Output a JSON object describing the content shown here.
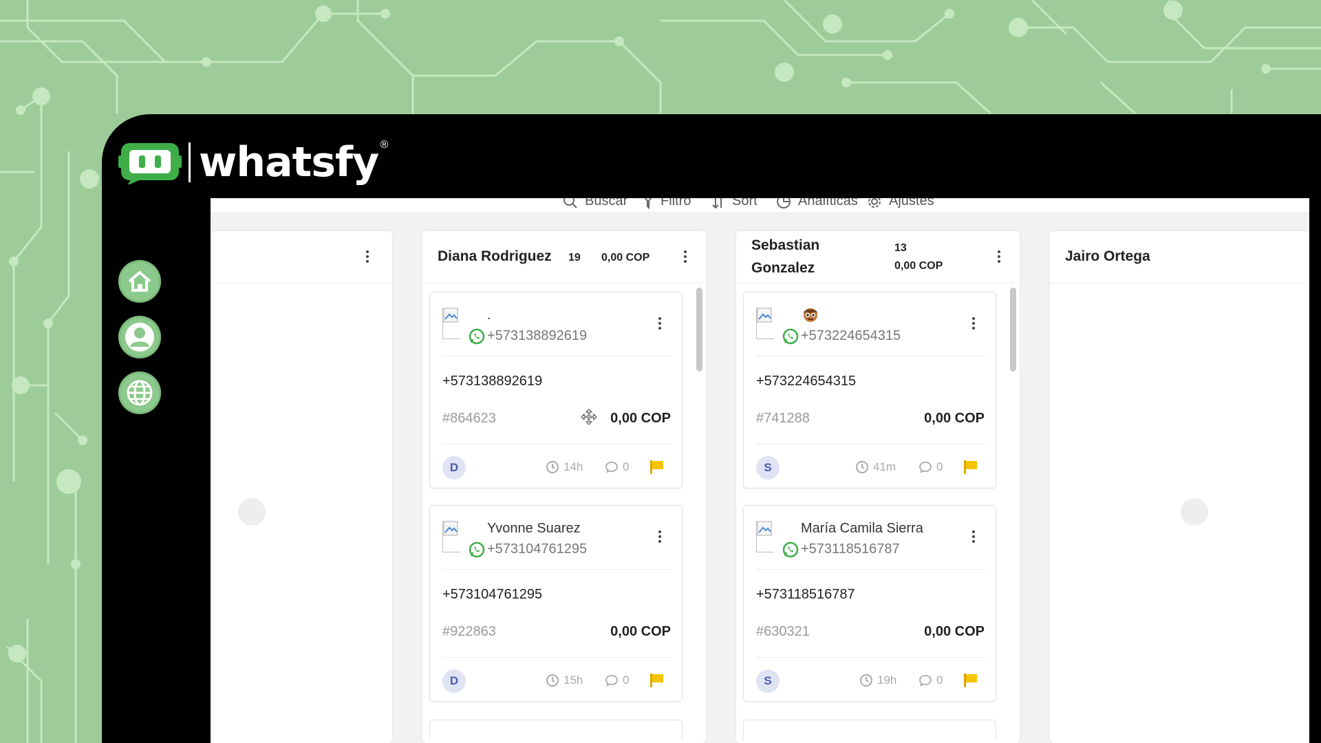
{
  "brand": {
    "name": "whatsfy",
    "registered": "®"
  },
  "nav": [
    {
      "icon": "home-icon"
    },
    {
      "icon": "user-icon"
    },
    {
      "icon": "globe-icon"
    }
  ],
  "toolbar": {
    "search": "Buscar",
    "filter": "Filtro",
    "sort": "Sort",
    "analytics": "Analíticas",
    "settings": "Ajustes"
  },
  "columns": [
    {
      "name": "",
      "count": "",
      "total": ""
    },
    {
      "name": "Diana Rodriguez",
      "count": "19",
      "total": "0,00 COP",
      "cards": [
        {
          "name": ".",
          "wa_phone": "+573138892619",
          "phone": "+573138892619",
          "id": "#864623",
          "amount": "0,00 COP",
          "agent": "D",
          "time": "14h",
          "messages": "0"
        },
        {
          "name": "Yvonne Suarez",
          "wa_phone": "+573104761295",
          "phone": "+573104761295",
          "id": "#922863",
          "amount": "0,00 COP",
          "agent": "D",
          "time": "15h",
          "messages": "0"
        }
      ]
    },
    {
      "name_line1": "Sebastian",
      "name_line2": "Gonzalez",
      "count": "13",
      "total": "0,00 COP",
      "cards": [
        {
          "name": "",
          "emoji": "face-emoji",
          "wa_phone": "+573224654315",
          "phone": "+573224654315",
          "id": "#741288",
          "amount": "0,00 COP",
          "agent": "S",
          "time": "41m",
          "messages": "0"
        },
        {
          "name": "María Camila Sierra",
          "wa_phone": "+573118516787",
          "phone": "+573118516787",
          "id": "#630321",
          "amount": "0,00 COP",
          "agent": "S",
          "time": "19h",
          "messages": "0"
        }
      ]
    },
    {
      "name": "Jairo Ortega"
    }
  ],
  "colors": {
    "background": "#9dcc98",
    "circuit": "#c6e8c1",
    "frame": "#000000",
    "nav_button": "#8cc98c",
    "badge_bg": "#dfe3f3",
    "badge_text": "#4a5cb0",
    "flag": "#f5c400"
  }
}
